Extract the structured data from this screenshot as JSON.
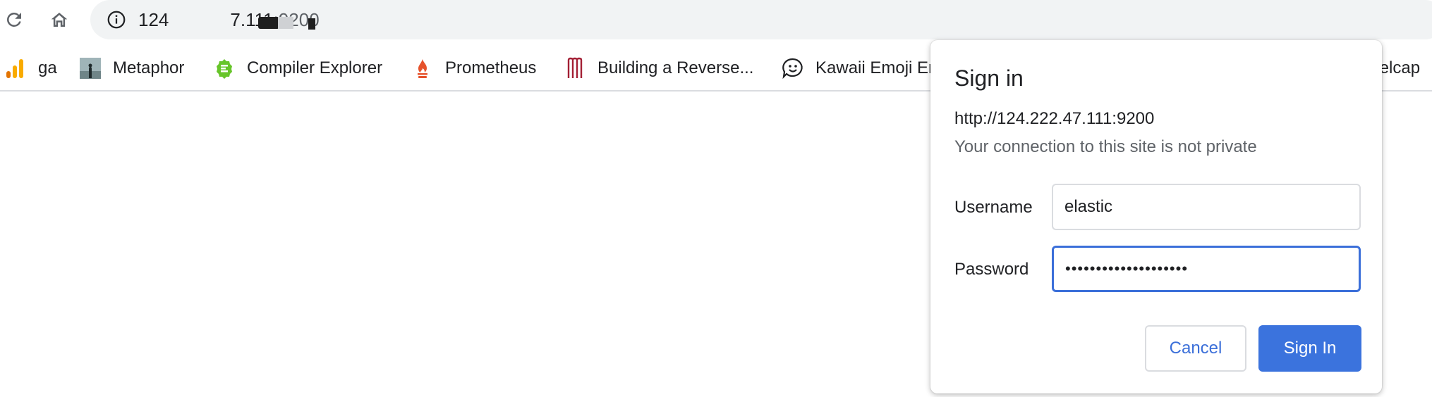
{
  "toolbar": {
    "url_host": "124",
    "url_host_rest": "7.111",
    "url_port": ":9200"
  },
  "bookmarks": [
    {
      "label": "ga",
      "icon": "analytics-bar-icon"
    },
    {
      "label": "Metaphor",
      "icon": "metaphor-image-icon"
    },
    {
      "label": "Compiler Explorer",
      "icon": "compiler-explorer-icon"
    },
    {
      "label": "Prometheus",
      "icon": "prometheus-flame-icon"
    },
    {
      "label": "Building a Reverse...",
      "icon": "tall-m-logo-icon"
    },
    {
      "label": "Kawaii Emoji En",
      "icon": "speech-bubble-face-icon"
    },
    {
      "label": "x elcap",
      "icon": ""
    }
  ],
  "dialog": {
    "title": "Sign in",
    "url": "http://124.222.47.111:9200",
    "warning": "Your connection to this site is not private",
    "username_label": "Username",
    "username_value": "elastic",
    "password_label": "Password",
    "password_value": "••••••••••••••••••••",
    "cancel_label": "Cancel",
    "signin_label": "Sign In"
  },
  "colors": {
    "accent": "#3b73dd",
    "omnibox_bg": "#f1f3f4",
    "secondary_text": "#5f6368"
  }
}
